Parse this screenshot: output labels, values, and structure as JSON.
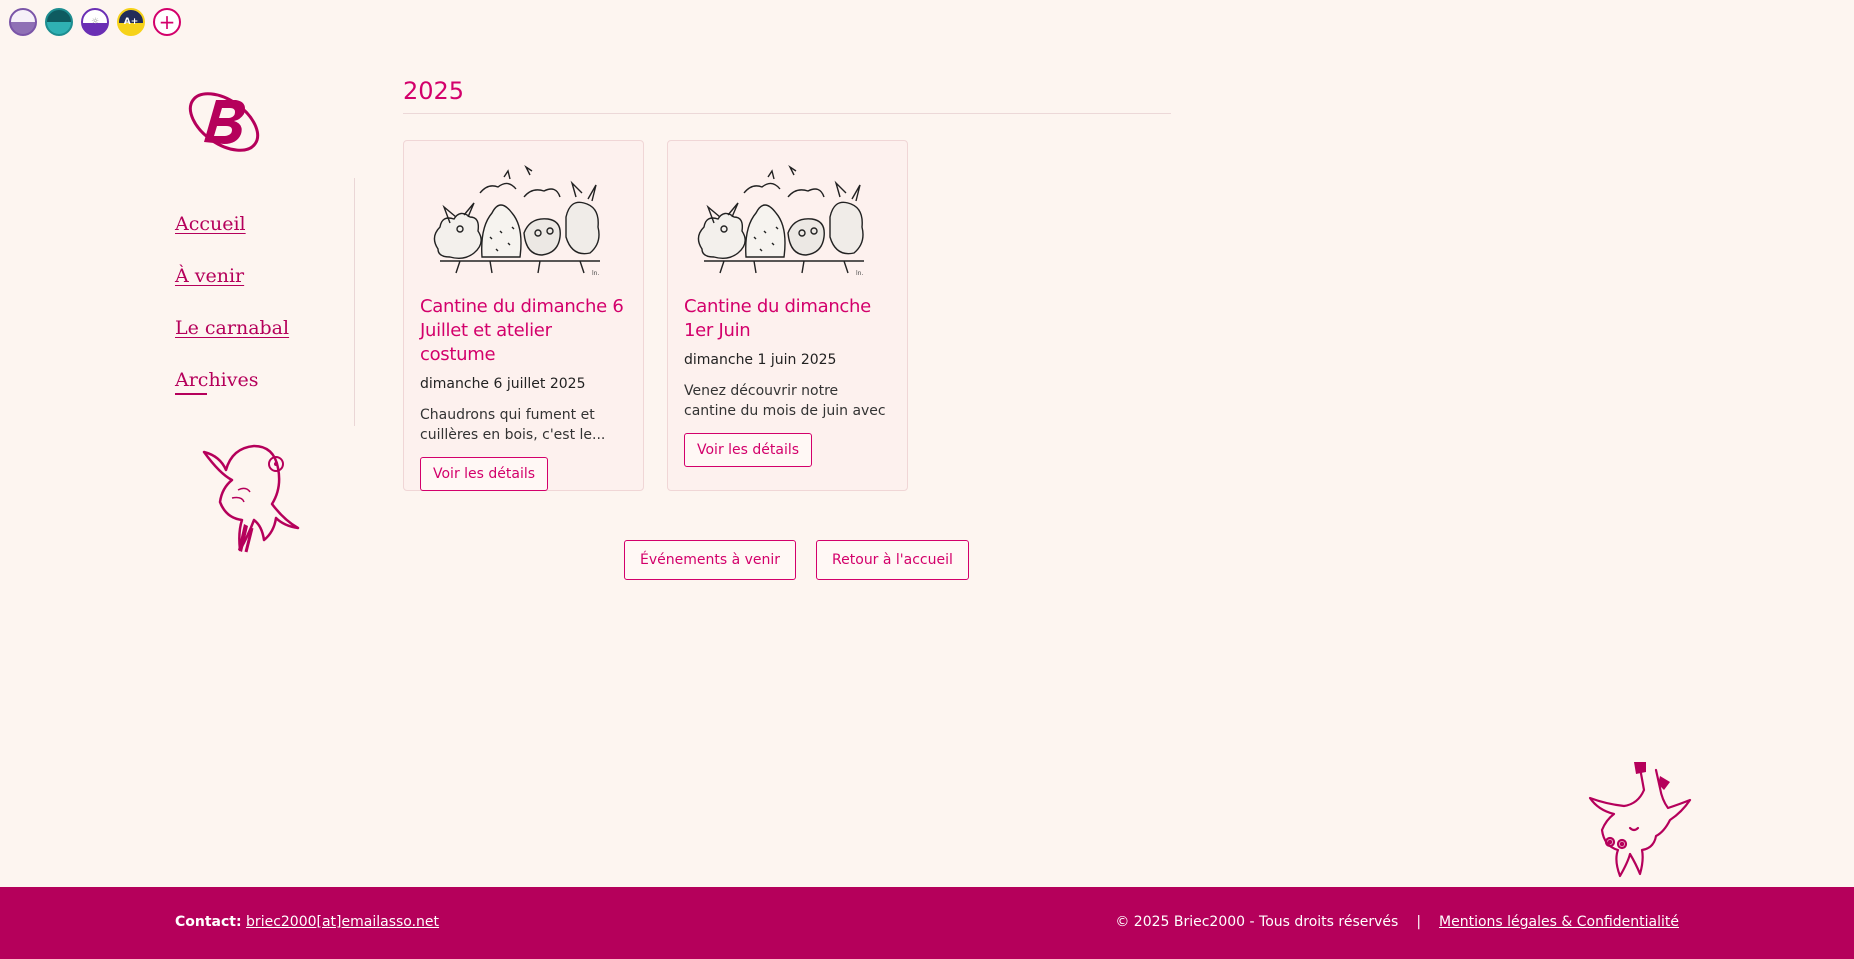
{
  "themes": [
    {
      "name": "theme-light-purple"
    },
    {
      "name": "theme-teal"
    },
    {
      "name": "theme-violet"
    },
    {
      "name": "theme-high-contrast",
      "label": "A+"
    },
    {
      "name": "theme-add",
      "label": "+"
    }
  ],
  "nav": {
    "items": [
      {
        "label": "Accueil"
      },
      {
        "label": "À venir"
      },
      {
        "label": "Le carnabal"
      },
      {
        "label": "Archives"
      }
    ]
  },
  "main": {
    "year": "2025",
    "cards": [
      {
        "title": "Cantine du dimanche 6 Juillet et atelier costume",
        "date": "dimanche 6 juillet 2025",
        "excerpt": "Chaudrons qui fument et cuillères en bois, c'est le...",
        "button": "Voir les détails"
      },
      {
        "title": "Cantine du dimanche 1er Juin",
        "date": "dimanche 1 juin 2025",
        "excerpt": "Venez découvrir notre cantine du mois de juin avec son bon...",
        "button": "Voir les détails"
      }
    ],
    "actions": {
      "upcoming": "Événements à venir",
      "home": "Retour à l'accueil"
    }
  },
  "footer": {
    "contact_label": "Contact:",
    "contact_email": "briec2000[at]emailasso.net",
    "copyright": "© 2025 Briec2000 - Tous droits réservés",
    "separator": "|",
    "legal": "Mentions légales & Confidentialité"
  },
  "colors": {
    "accent": "#d3006b",
    "footer": "#b5005b",
    "background": "#fdf5f0"
  }
}
